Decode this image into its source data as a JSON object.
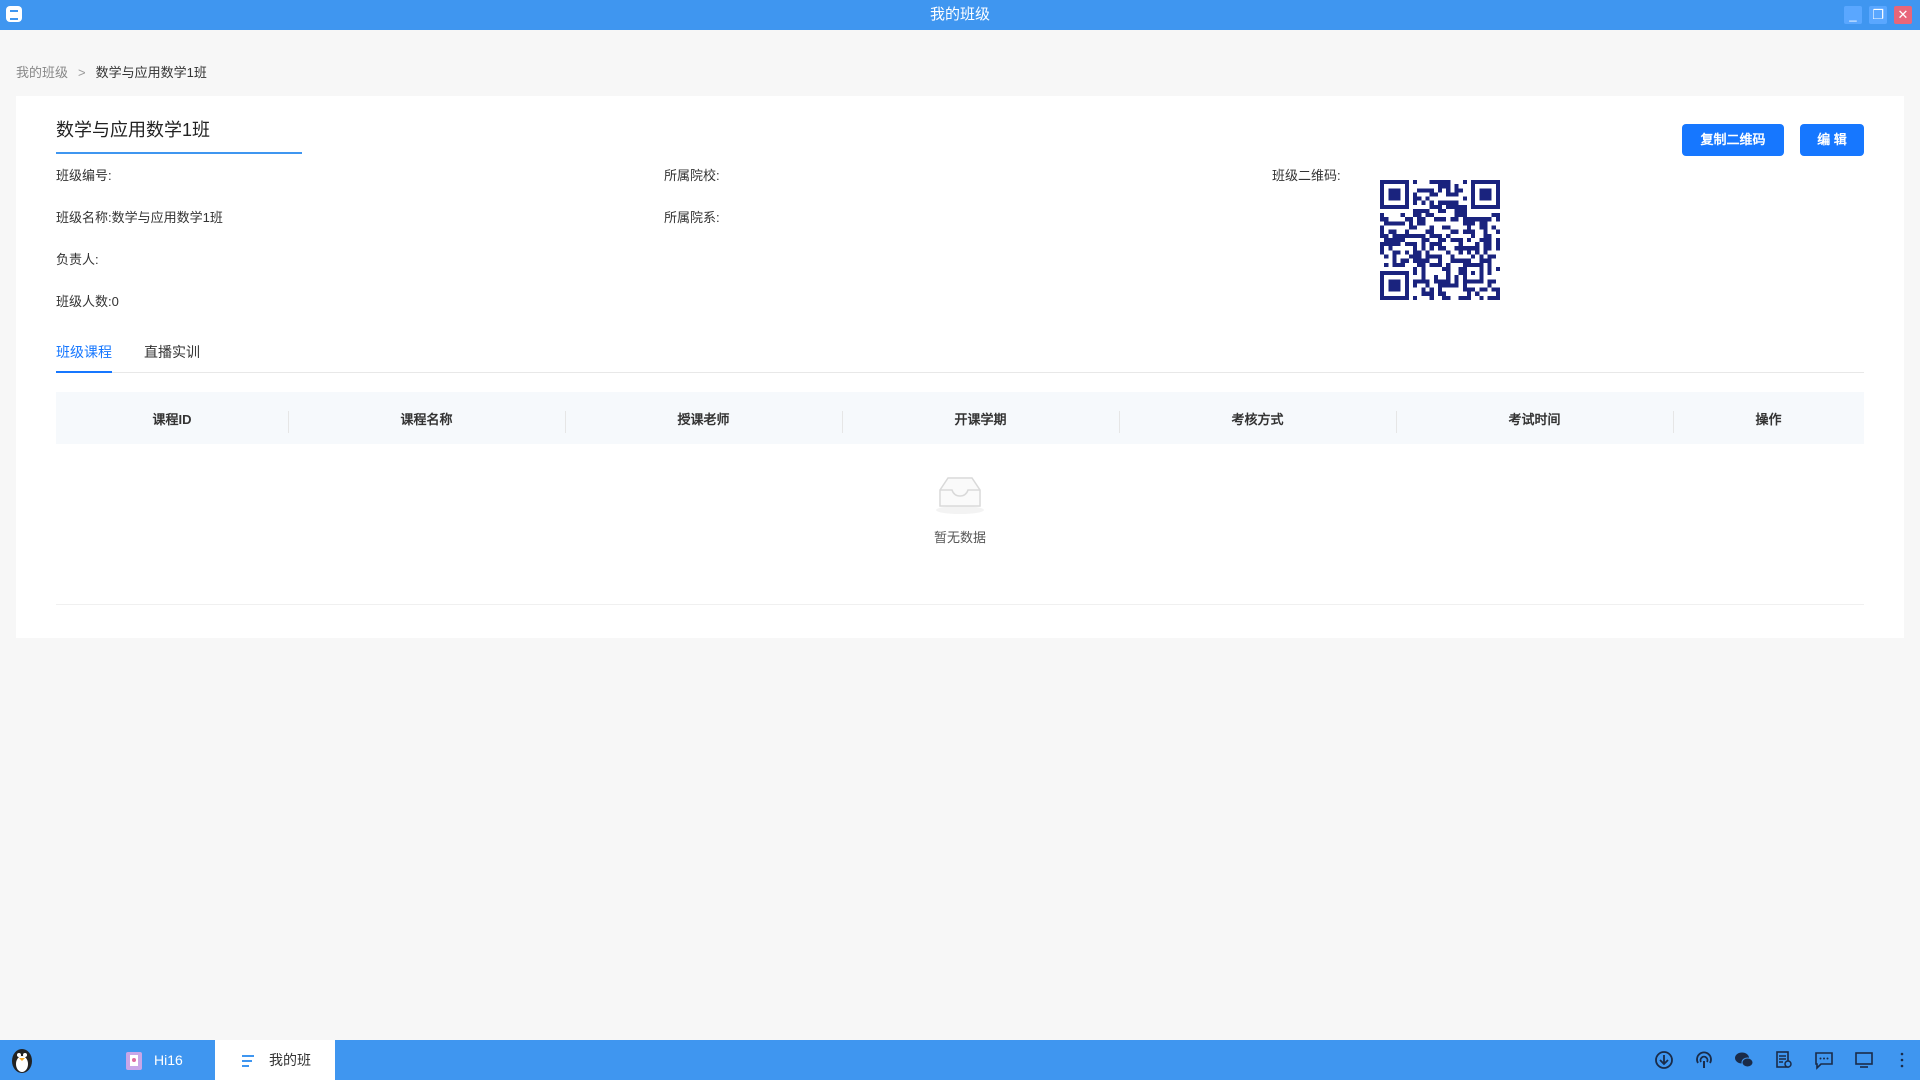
{
  "window": {
    "title": "我的班级"
  },
  "breadcrumb": {
    "root": "我的班级",
    "separator": ">",
    "current": "数学与应用数学1班"
  },
  "class": {
    "title": "数学与应用数学1班",
    "fields": {
      "id_label": "班级编号:",
      "id_value": "",
      "name_label": "班级名称:",
      "name_value": "数学与应用数学1班",
      "owner_label": "负责人:",
      "owner_value": "",
      "count_label": "班级人数:",
      "count_value": "0",
      "school_label": "所属院校:",
      "school_value": "",
      "dept_label": "所属院系:",
      "dept_value": "",
      "qr_label": "班级二维码:"
    }
  },
  "actions": {
    "copy_qr": "复制二维码",
    "edit": "编 辑"
  },
  "tabs": [
    {
      "label": "班级课程",
      "active": true
    },
    {
      "label": "直播实训",
      "active": false
    }
  ],
  "table": {
    "columns": [
      "课程ID",
      "课程名称",
      "授课老师",
      "开课学期",
      "考核方式",
      "考试时间",
      "操作"
    ],
    "rows": [],
    "empty_text": "暂无数据"
  },
  "taskbar": {
    "items": [
      {
        "label": "Hi16"
      },
      {
        "label": "我的班"
      }
    ],
    "tray_icons": [
      "download-icon",
      "podcast-icon",
      "wechat-icon",
      "document-search-icon",
      "chat-icon",
      "monitor-icon",
      "more-icon"
    ]
  },
  "colors": {
    "accent": "#3f96f0",
    "button": "#1677ff",
    "qr": "#1a237e"
  }
}
